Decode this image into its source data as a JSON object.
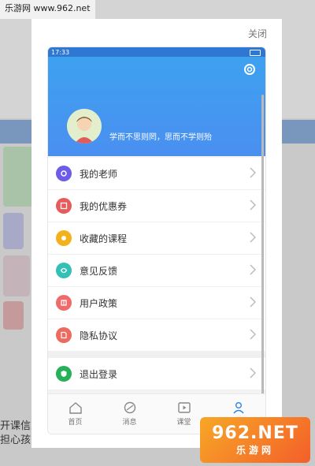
{
  "watermark": {
    "site": "乐游网 www.962.net",
    "logo_text": "962.NET",
    "logo_sub": "乐游网"
  },
  "background": {
    "bottom_text_line1": "开课信息",
    "bottom_text_line2": "担心孩"
  },
  "modal": {
    "close_label": "关闭"
  },
  "status_bar": {
    "time": "17:33",
    "signal": "\"3d\" 信号"
  },
  "profile": {
    "motto": "学而不思则罔，思而不学则殆"
  },
  "menu": [
    {
      "label": "我的老师",
      "icon": "teacher-icon",
      "color": "#6c5ce7"
    },
    {
      "label": "我的优惠券",
      "icon": "coupon-icon",
      "color": "#e85b5b"
    },
    {
      "label": "收藏的课程",
      "icon": "favorite-course-icon",
      "color": "#f3b21b"
    },
    {
      "label": "意见反馈",
      "icon": "feedback-icon",
      "color": "#33c0b7"
    },
    {
      "label": "用户政策",
      "icon": "user-policy-icon",
      "color": "#ef6b6b"
    },
    {
      "label": "隐私协议",
      "icon": "privacy-icon",
      "color": "#ee6a5e"
    }
  ],
  "logout": {
    "label": "退出登录",
    "icon": "logout-icon",
    "color": "#27b05a"
  },
  "tabs": [
    {
      "label": "首页",
      "icon": "home-icon"
    },
    {
      "label": "消息",
      "icon": "message-icon"
    },
    {
      "label": "课堂",
      "icon": "classroom-icon"
    },
    {
      "label": "我的",
      "icon": "profile-icon",
      "active": true
    }
  ],
  "colors": {
    "accent": "#2e86de",
    "header_top": "#3ea1f0",
    "header_bottom": "#4a8ff0"
  }
}
